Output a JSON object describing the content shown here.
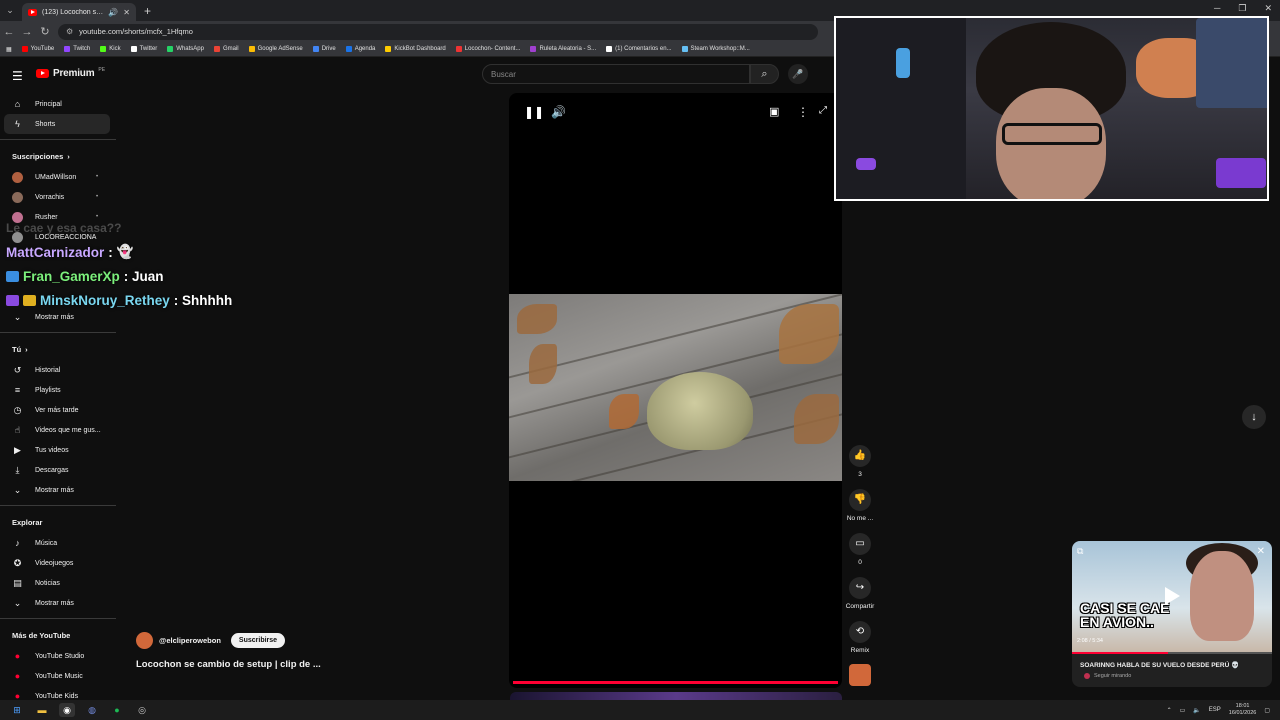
{
  "browser": {
    "tab_title": "(123) Locochon se cambio",
    "url": "youtube.com/shorts/mcfx_1Hfqmo",
    "bookmarks": [
      "YouTube",
      "Twitch",
      "Kick",
      "Twitter",
      "WhatsApp",
      "Gmail",
      "Google AdSense",
      "Drive",
      "Agenda",
      "KickBot Dashboard",
      "Locochon- Content...",
      "Ruleta Aleatoria - S...",
      "(1) Comentarios en...",
      "Steam Workshop::M..."
    ],
    "bookmark_colors": [
      "#ff0000",
      "#9146ff",
      "#53fc18",
      "#ffffff",
      "#25d366",
      "#ea4335",
      "#fbbc04",
      "#4285f4",
      "#1a73e8",
      "#ffcc00",
      "#e33",
      "#a040d0",
      "#ffffff",
      "#66c0f4"
    ]
  },
  "youtube": {
    "logo_text": "Premium",
    "logo_sup": "PE",
    "search_placeholder": "Buscar"
  },
  "sidebar": {
    "main": [
      {
        "label": "Principal",
        "icon": "home-icon",
        "glyph": "⌂"
      },
      {
        "label": "Shorts",
        "icon": "shorts-icon",
        "glyph": "ϟ"
      }
    ],
    "subs_header": "Suscripciones",
    "subs": [
      {
        "label": "UMadWillson",
        "color": "#b06040"
      },
      {
        "label": "Vorrachis",
        "color": "#8a6a5a"
      },
      {
        "label": "Rusher",
        "color": "#c07090"
      },
      {
        "label": "LOCOREACCIONA",
        "color": "#909090"
      }
    ],
    "subs_more": "Mostrar más",
    "you_header": "Tú",
    "you": [
      {
        "label": "Historial",
        "icon": "history-icon",
        "glyph": "↺"
      },
      {
        "label": "Playlists",
        "icon": "playlists-icon",
        "glyph": "≡"
      },
      {
        "label": "Ver más tarde",
        "icon": "watch-later-icon",
        "glyph": "◷"
      },
      {
        "label": "Videos que me gus...",
        "icon": "like-icon",
        "glyph": "👍"
      },
      {
        "label": "Tus videos",
        "icon": "your-videos-icon",
        "glyph": "▶"
      },
      {
        "label": "Descargas",
        "icon": "downloads-icon",
        "glyph": "⤓"
      }
    ],
    "you_more": "Mostrar más",
    "explore_header": "Explorar",
    "explore": [
      {
        "label": "Música",
        "icon": "music-icon",
        "glyph": "♪"
      },
      {
        "label": "Videojuegos",
        "icon": "gaming-icon",
        "glyph": "✪"
      },
      {
        "label": "Noticias",
        "icon": "news-icon",
        "glyph": "▤"
      }
    ],
    "explore_more": "Mostrar más",
    "more_header": "Más de YouTube",
    "more": [
      {
        "label": "YouTube Studio"
      },
      {
        "label": "YouTube Music"
      },
      {
        "label": "YouTube Kids"
      }
    ]
  },
  "chat": {
    "ghost": "Le cae y esa casa??",
    "messages": [
      {
        "user": "MattCarnizador",
        "text": "",
        "color": "#c8a8ff",
        "emote": "👻"
      },
      {
        "user": "Fran_GamerXp",
        "text": ": Juan",
        "color": "#7cf07c"
      },
      {
        "user": "MinskNoruy_Rethey",
        "text": ": Shhhhh",
        "color": "#7ad7f0"
      }
    ]
  },
  "short": {
    "channel": "@elcliperowebon",
    "subscribe_label": "Suscribirse",
    "title": "Locochon se cambio de setup | clip de ...",
    "progress": 1.0
  },
  "actions": [
    {
      "name": "like",
      "glyph": "👍",
      "label": "3"
    },
    {
      "name": "dislike",
      "glyph": "👎",
      "label": "No me ..."
    },
    {
      "name": "comments",
      "glyph": "▭",
      "label": "0"
    },
    {
      "name": "share",
      "glyph": "↪",
      "label": "Compartir"
    },
    {
      "name": "remix",
      "glyph": "⟲",
      "label": "Remix"
    }
  ],
  "miniplayer": {
    "thumb_text_1": "CASI SE CAE",
    "thumb_text_2": "EN AVION..",
    "time": "2:08 / 5:34",
    "title": "SOARINNG HABLA DE SU VUELO DESDE PERÚ 💀",
    "subtitle": "Seguir mirando",
    "progress": 0.48
  },
  "tray": {
    "lang": "ESP",
    "time": "18:01",
    "date": "16/01/2026"
  }
}
